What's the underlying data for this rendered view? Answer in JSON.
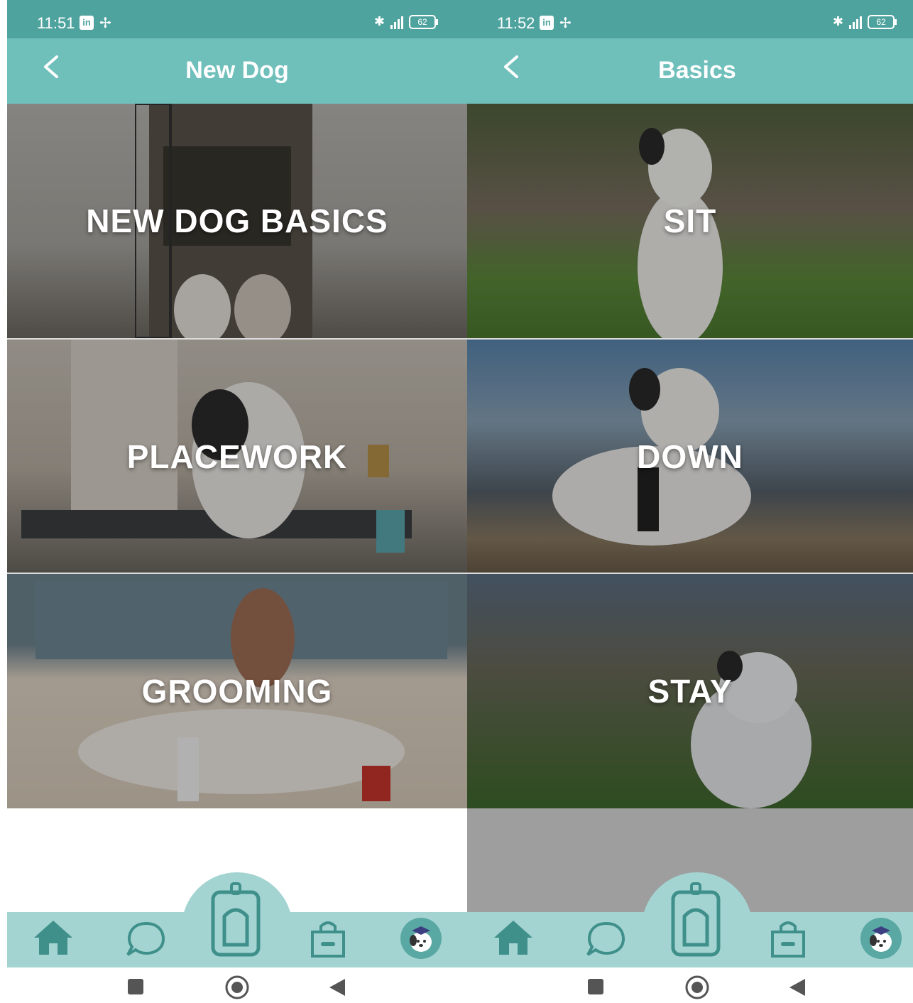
{
  "left_screen": {
    "status_bar": {
      "time": "11:51",
      "battery": "62"
    },
    "header": {
      "title": "New Dog"
    },
    "tiles": [
      {
        "label": "NEW DOG BASICS",
        "bg": "#9a9a94"
      },
      {
        "label": "PLACEWORK",
        "bg": "#a59c92"
      },
      {
        "label": "GROOMING",
        "bg": "#9c8e80"
      }
    ],
    "content_bg": "#ffffff"
  },
  "right_screen": {
    "status_bar": {
      "time": "11:52",
      "battery": "62"
    },
    "header": {
      "title": "Basics"
    },
    "tiles": [
      {
        "label": "SIT",
        "bg": "#5e7a4a"
      },
      {
        "label": "DOWN",
        "bg": "#6f7f8c"
      },
      {
        "label": "STAY",
        "bg": "#5e6f52"
      }
    ],
    "content_bg": "#9e9e9e"
  },
  "colors": {
    "status_bar": "#4fa39e",
    "header": "#6fbfbb",
    "bottom_nav": "#a3d4d1",
    "nav_icon": "#3f8f8b"
  },
  "bottom_nav": {
    "items": [
      "home-icon",
      "chat-icon",
      "clicker-icon",
      "shop-bag-icon",
      "profile-avatar-icon"
    ]
  },
  "system_nav": {
    "items": [
      "recents-icon",
      "home-circle-icon",
      "back-triangle-icon"
    ]
  }
}
